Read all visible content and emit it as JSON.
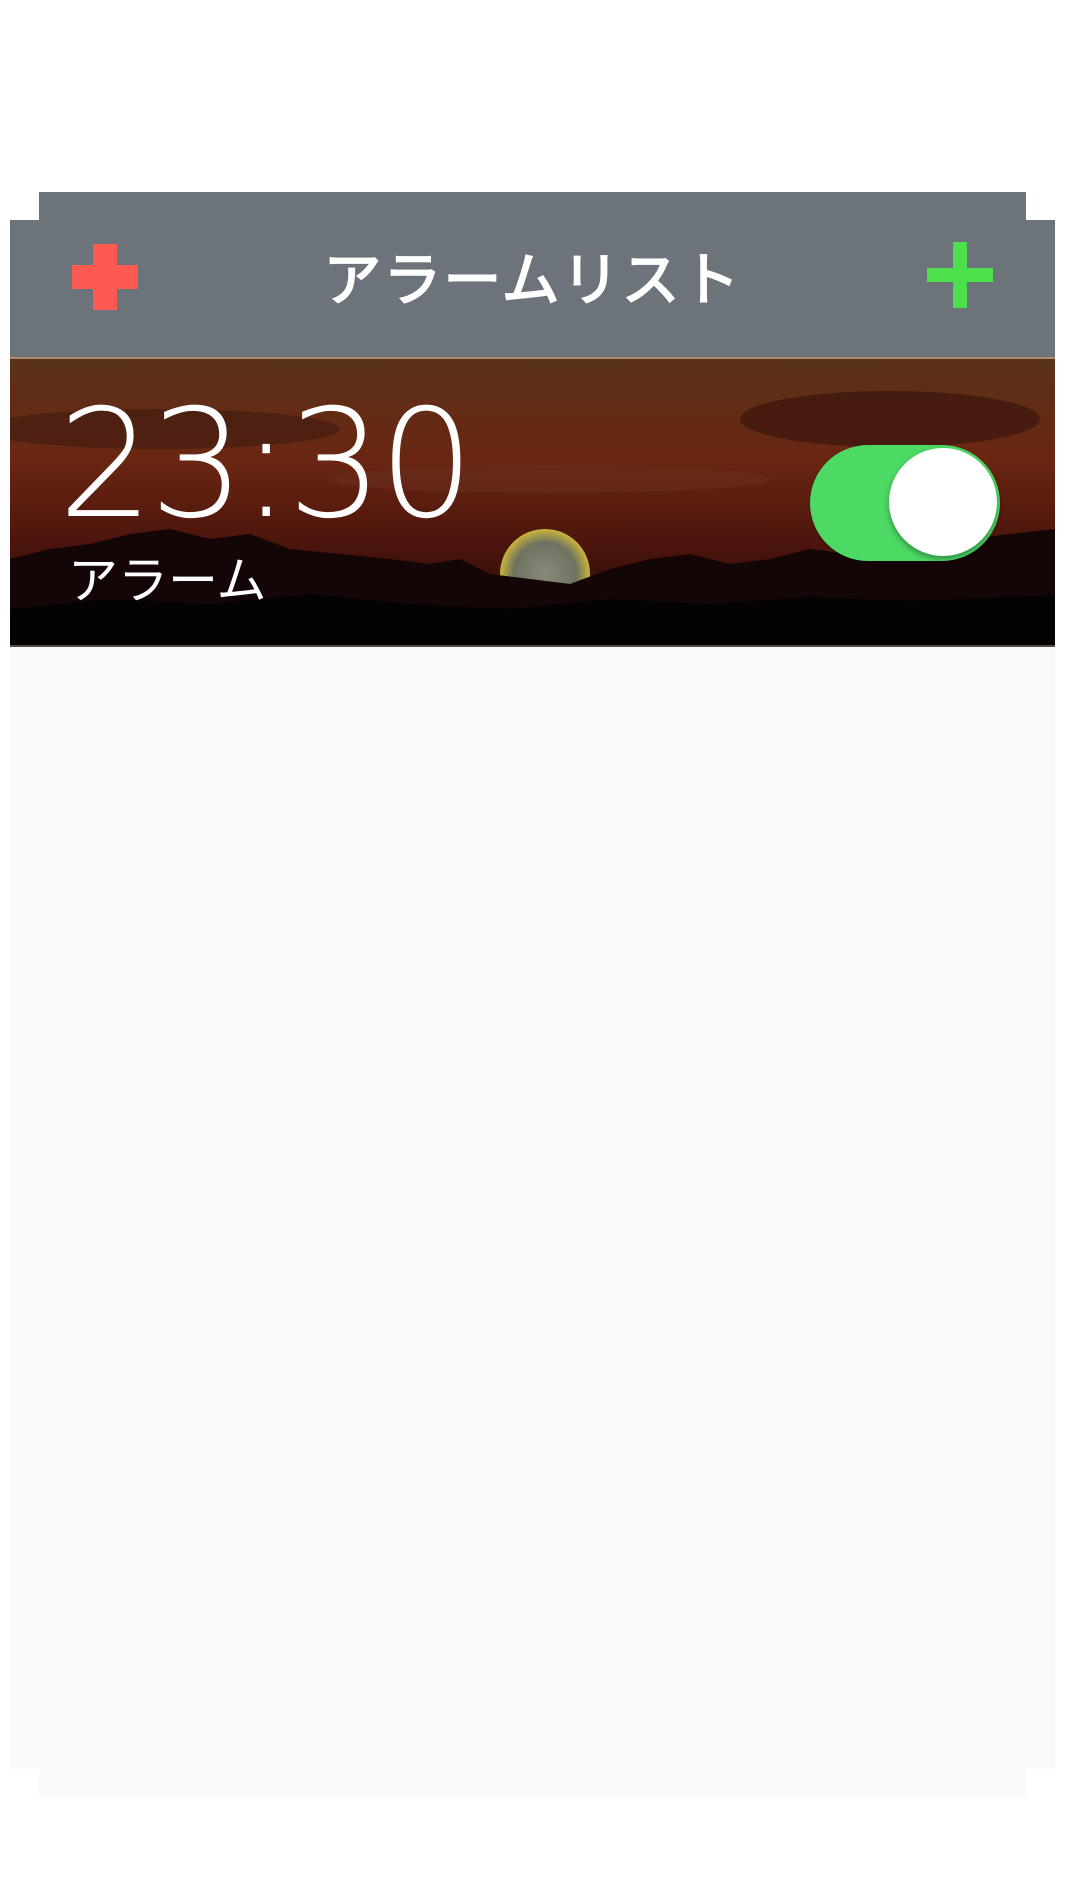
{
  "navbar": {
    "title": "アラームリスト",
    "left_icon": "red-plus-icon",
    "right_icon": "green-plus-icon"
  },
  "alarms": [
    {
      "time": "23:30",
      "label": "アラーム",
      "enabled": true
    }
  ],
  "colors": {
    "navbar_bg": "#6c737b",
    "left_icon": "#ff5a52",
    "right_icon": "#4ce14c",
    "toggle_on": "#4cd964",
    "content_bg": "#f9f9f9"
  }
}
